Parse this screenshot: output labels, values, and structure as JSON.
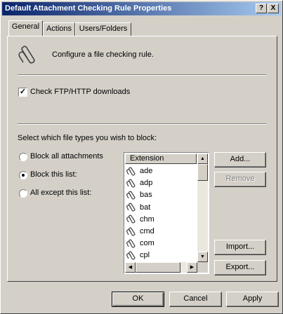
{
  "window": {
    "title": "Default Attachment Checking Rule Properties",
    "help_label": "?",
    "close_label": "X"
  },
  "tabs": [
    {
      "label": "General",
      "active": true
    },
    {
      "label": "Actions",
      "active": false
    },
    {
      "label": "Users/Folders",
      "active": false
    }
  ],
  "general": {
    "description": "Configure a file checking rule.",
    "icon": "paperclip-icon",
    "check_ftp_label": "Check FTP/HTTP downloads",
    "check_ftp_checked": true,
    "select_prompt": "Select which file types you wish to block:",
    "radio_options": [
      {
        "label": "Block all attachments",
        "selected": false
      },
      {
        "label": "Block this list:",
        "selected": true
      },
      {
        "label": "All except this list:",
        "selected": false
      }
    ]
  },
  "extension_list": {
    "header": "Extension",
    "items": [
      "ade",
      "adp",
      "bas",
      "bat",
      "chm",
      "cmd",
      "com",
      "cpl"
    ],
    "item_icon": "paperclip-icon"
  },
  "side_buttons": {
    "add": "Add...",
    "remove": "Remove",
    "import": "Import...",
    "export": "Export..."
  },
  "footer": {
    "ok": "OK",
    "cancel": "Cancel",
    "apply": "Apply"
  },
  "colors": {
    "titlebar_start": "#0a246a",
    "titlebar_end": "#a6caf0",
    "face": "#d4d0c8"
  }
}
